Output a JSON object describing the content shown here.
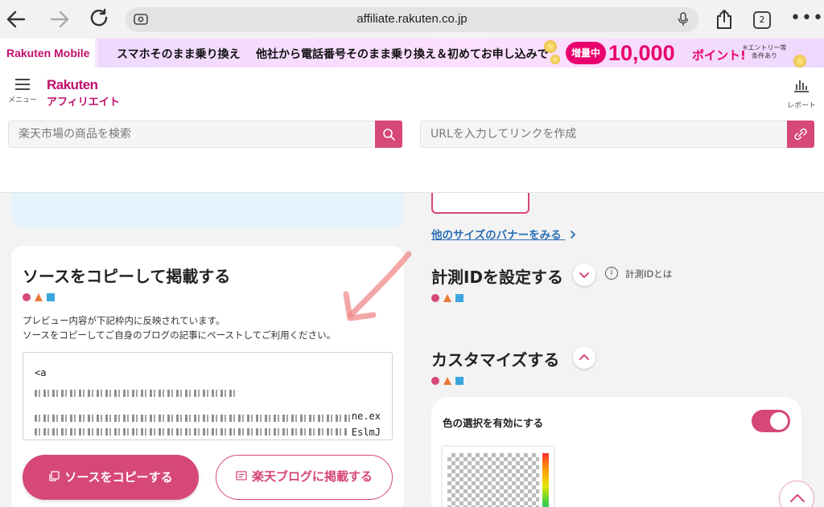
{
  "browser": {
    "url": "affiliate.rakuten.co.jp",
    "tab_count": "2"
  },
  "ad": {
    "brand": "Rakuten Mobile",
    "headline": "スマホそのまま乗り換え",
    "body": "他社から電話番号そのまま乗り換え＆初めてお申し込みで",
    "badge": "増量中",
    "points_number": "10,000",
    "points_unit": "ポイント!",
    "note_line1": "※エントリー等",
    "note_line2": "条件あり"
  },
  "header": {
    "menu_label": "メニュー",
    "brand_line1": "Rakuten",
    "brand_line2": "アフィリエイト",
    "report_label": "レポート",
    "search_placeholder": "楽天市場の商品を検索",
    "url_placeholder": "URLを入力してリンクを作成"
  },
  "source_card": {
    "title": "ソースをコピーして掲載する",
    "desc_line1": "プレビュー内容が下記枠内に反映されています。",
    "desc_line2": "ソースをコピーしてご自身のブログの記事にペーストしてご利用ください。",
    "code_start": "<a",
    "code_fragment1": "ne.ex",
    "code_fragment2": "EslmJ",
    "copy_button": "ソースをコピーする",
    "blog_button": "楽天ブログに掲載する"
  },
  "right": {
    "more_banners_link": "他のサイズのバナーをみる",
    "measure_title": "計測IDを設定する",
    "measure_info": "計測IDとは",
    "customize_title": "カスタマイズする",
    "color_toggle_label": "色の選択を有効にする",
    "color_toggle_on": true
  },
  "colors": {
    "accent": "#d6477a",
    "brand": "#bf0f6d",
    "link": "#2a6fb3"
  }
}
